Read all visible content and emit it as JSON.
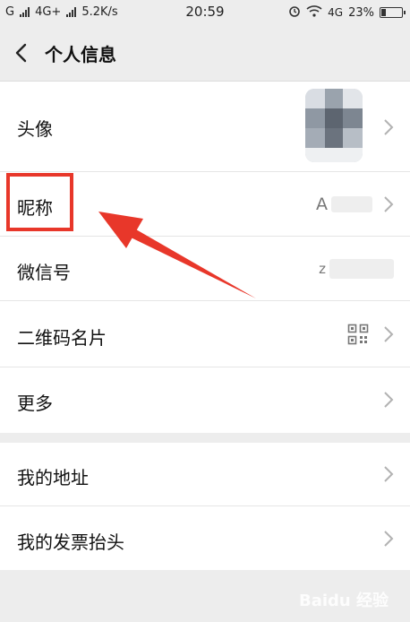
{
  "status_bar": {
    "carrier1": "G",
    "network": "4G+",
    "speed": "5.2K/s",
    "time": "20:59",
    "network_right": "4G",
    "battery": "23%",
    "battery_level": 0.23
  },
  "header": {
    "title": "个人信息"
  },
  "rows": {
    "avatar": {
      "label": "头像"
    },
    "nickname": {
      "label": "昵称",
      "value": "A"
    },
    "wechat_id": {
      "label": "微信号",
      "value": "z"
    },
    "qr_card": {
      "label": "二维码名片"
    },
    "more": {
      "label": "更多"
    },
    "address": {
      "label": "我的地址"
    },
    "invoice": {
      "label": "我的发票抬头"
    }
  },
  "watermark": {
    "text": "Baidu 经验"
  },
  "colors": {
    "highlight": "#e8372a",
    "background": "#ededed",
    "row_bg": "#ffffff"
  }
}
